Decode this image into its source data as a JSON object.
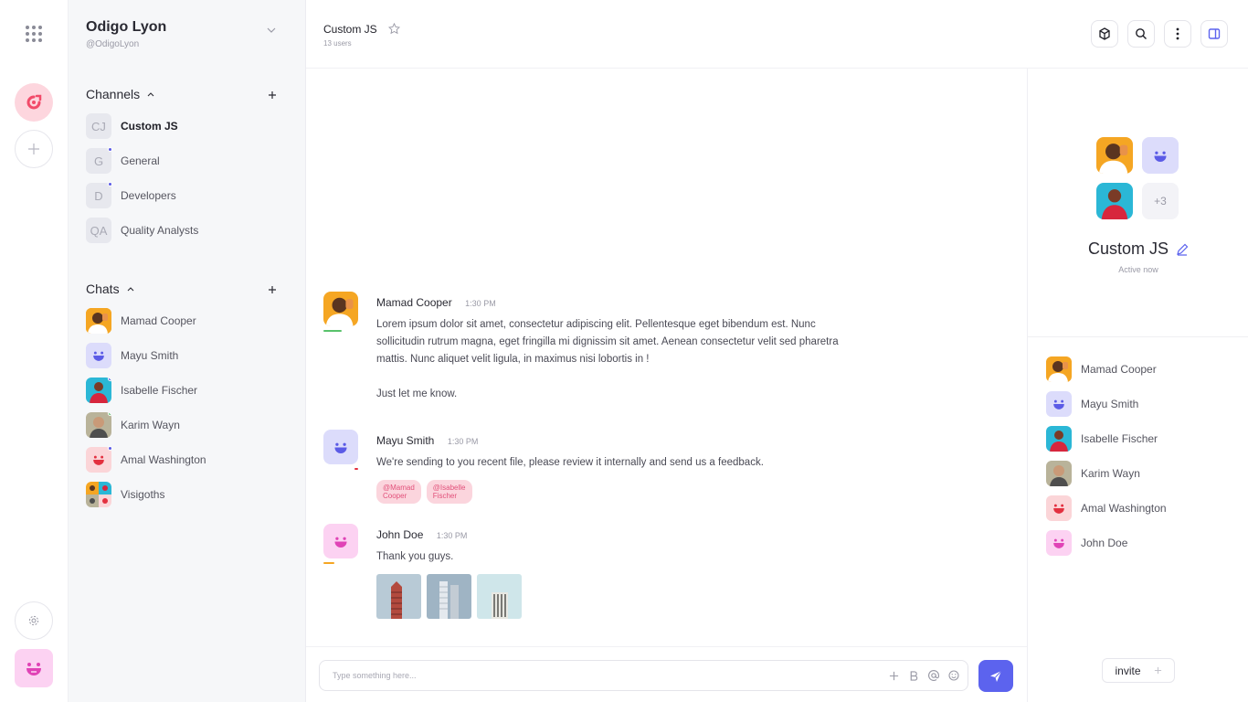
{
  "workspace": {
    "name": "Odigo Lyon",
    "handle": "@OdigoLyon"
  },
  "channels": {
    "title": "Channels",
    "items": [
      {
        "initials": "CJ",
        "label": "Custom JS",
        "active": true
      },
      {
        "initials": "G",
        "label": "General",
        "unread": true
      },
      {
        "initials": "D",
        "label": "Developers",
        "unread": true
      },
      {
        "initials": "QA",
        "label": "Quality Analysts"
      }
    ]
  },
  "chats": {
    "title": "Chats",
    "items": [
      {
        "label": "Mamad Cooper"
      },
      {
        "label": "Mayu Smith"
      },
      {
        "label": "Isabelle Fischer"
      },
      {
        "label": "Karim Wayn"
      },
      {
        "label": "Amal Washington"
      },
      {
        "label": "Visigoths"
      }
    ]
  },
  "header": {
    "title": "Custom JS",
    "subtitle": "13 users"
  },
  "messages": [
    {
      "name": "Mamad Cooper",
      "time": "1:30 PM",
      "text": "Lorem ipsum dolor sit amet, consectetur adipiscing elit. Pellentesque eget bibendum est. Nunc sollicitudin rutrum magna, eget fringilla mi dignissim sit amet. Aenean consectetur velit sed pharetra mattis. Nunc aliquet velit ligula, in maximus nisi lobortis in !",
      "text2": "Just let me know."
    },
    {
      "name": "Mayu Smith",
      "time": "1:30 PM",
      "text": "We're sending to you recent file, please review it internally and send us a feedback.",
      "tags": [
        "@Mamad Cooper",
        "@Isabelle Fischer"
      ]
    },
    {
      "name": "John Doe",
      "time": "1:30 PM",
      "text": "Thank you guys."
    }
  ],
  "composer": {
    "placeholder": "Type something here..."
  },
  "panel": {
    "title": "Custom JS",
    "status": "Active now",
    "more_count": "+3",
    "members": [
      "Mamad Cooper",
      "Mayu Smith",
      "Isabelle Fischer",
      "Karim Wayn",
      "Amal Washington",
      "John Doe"
    ],
    "invite_label": "invite"
  },
  "colors": {
    "accent": "#5c63ee",
    "brand": "#f24b6a",
    "online": "#58c26b"
  }
}
